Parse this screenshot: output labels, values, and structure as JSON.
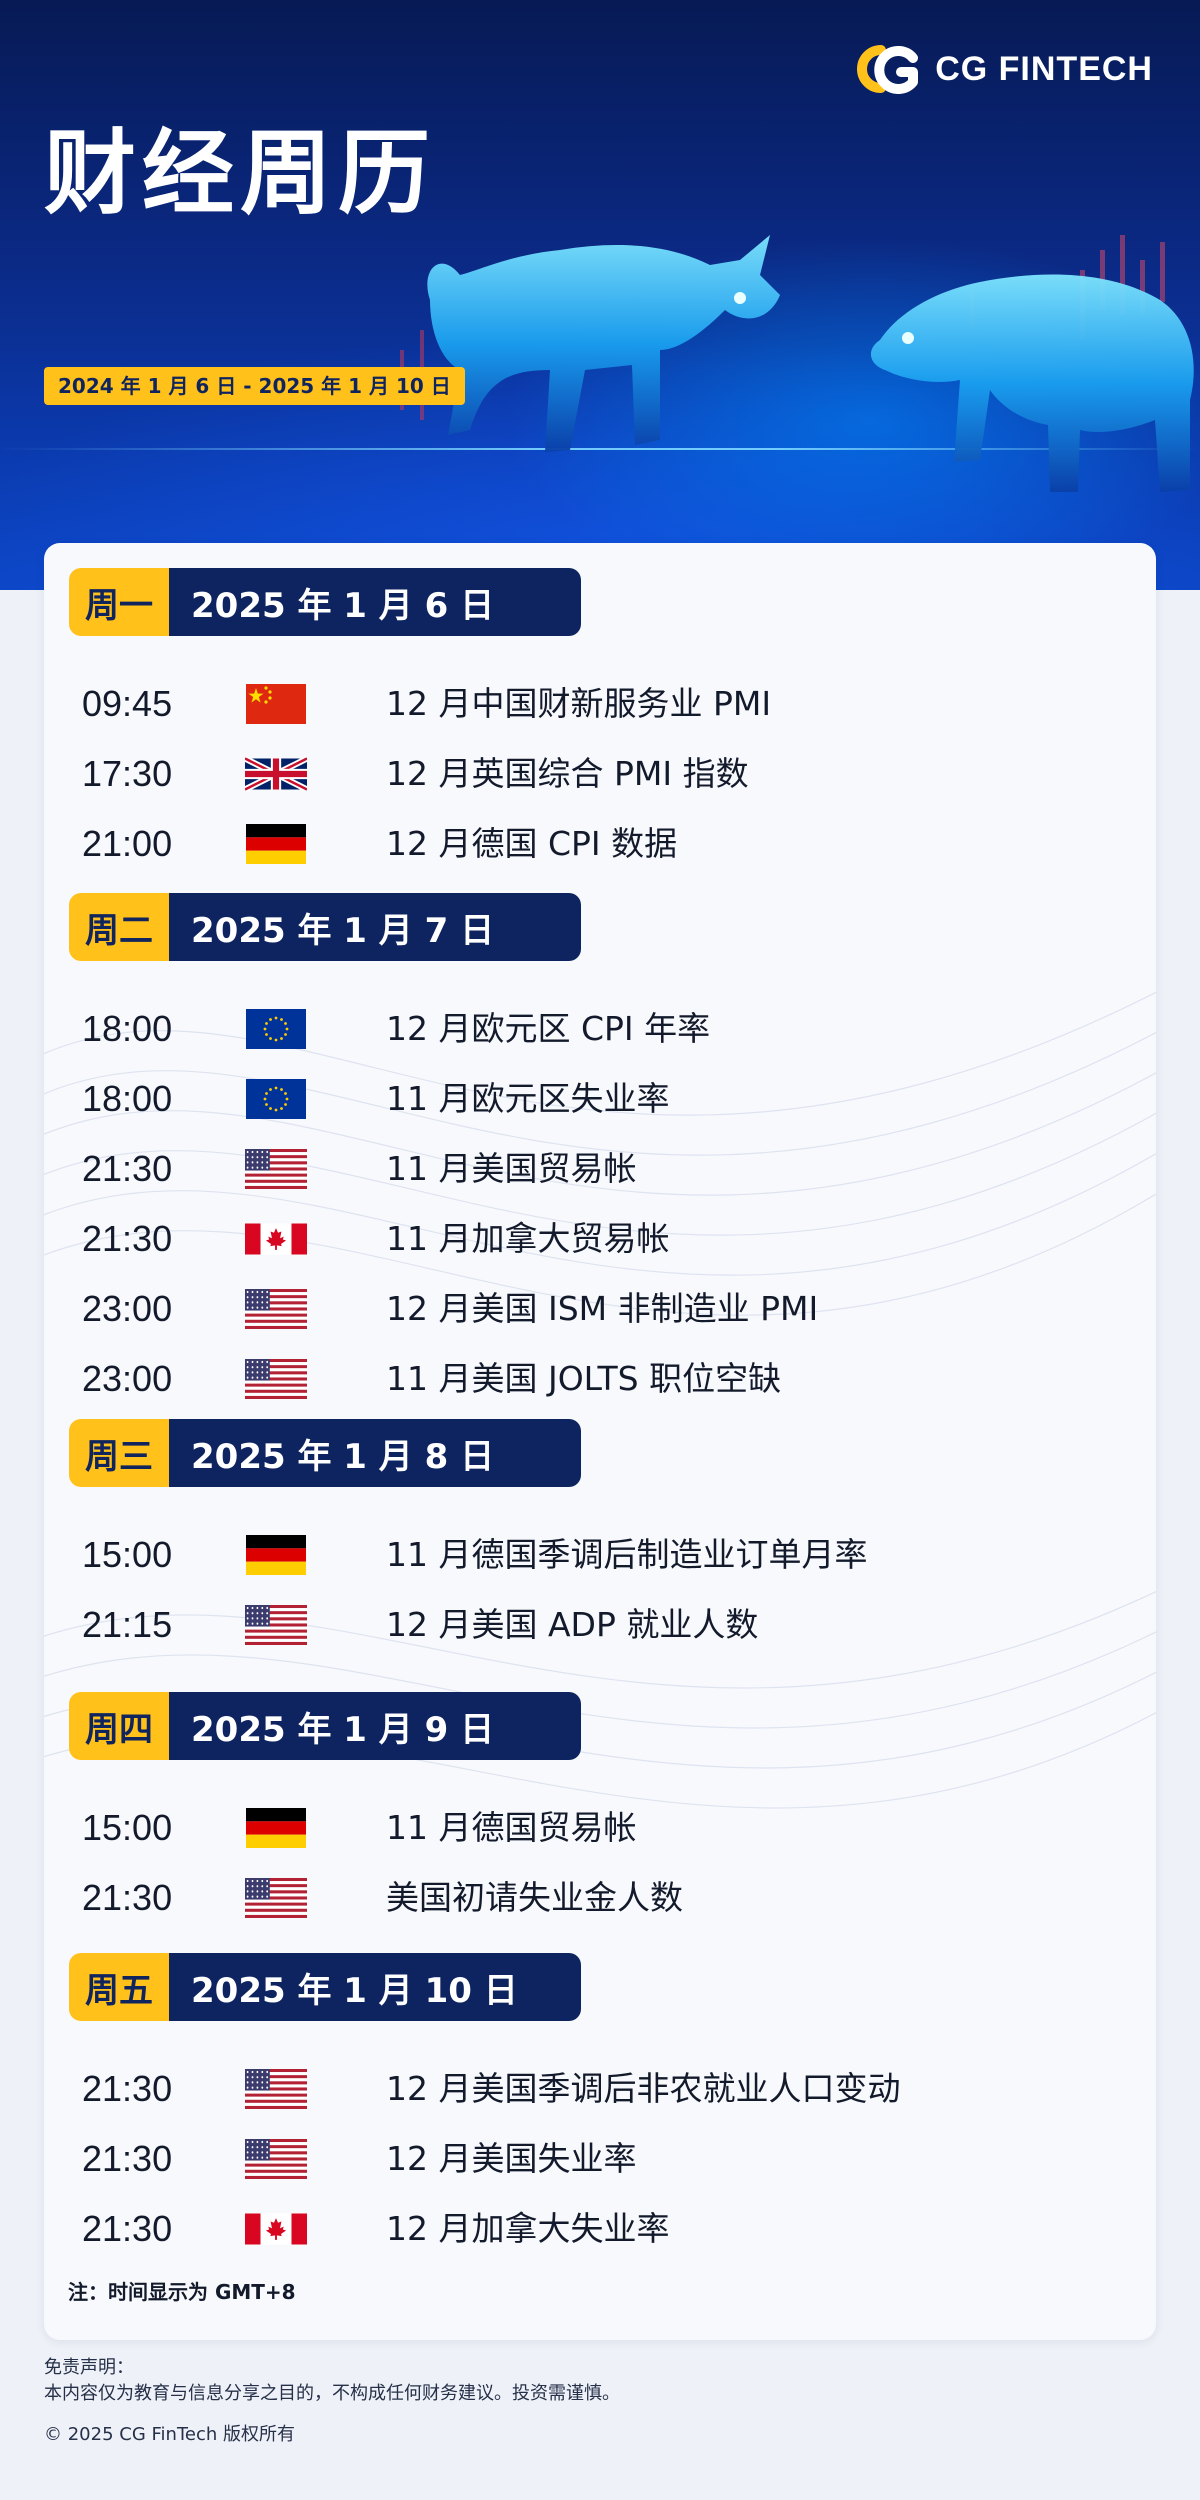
{
  "brand": {
    "logo_text": "CG FINTECH"
  },
  "hero": {
    "title": "财经周历",
    "date_range": "2024 年 1 月 6 日 - 2025 年 1 月 10 日"
  },
  "days": [
    {
      "weekday": "周一",
      "date": "2025 年 1 月 6 日",
      "events": [
        {
          "time": "09:45",
          "country": "cn",
          "title": "12 月中国财新服务业 PMI"
        },
        {
          "time": "17:30",
          "country": "uk",
          "title": "12 月英国综合 PMI 指数"
        },
        {
          "time": "21:00",
          "country": "de",
          "title": "12 月德国 CPI 数据"
        }
      ]
    },
    {
      "weekday": "周二",
      "date": "2025 年 1 月 7 日",
      "events": [
        {
          "time": "18:00",
          "country": "eu",
          "title": "12 月欧元区 CPI 年率"
        },
        {
          "time": "18:00",
          "country": "eu",
          "title": "11 月欧元区失业率"
        },
        {
          "time": "21:30",
          "country": "us",
          "title": "11 月美国贸易帐"
        },
        {
          "time": "21:30",
          "country": "ca",
          "title": "11 月加拿大贸易帐"
        },
        {
          "time": "23:00",
          "country": "us",
          "title": "12 月美国 ISM 非制造业 PMI"
        },
        {
          "time": "23:00",
          "country": "us",
          "title": "11 月美国 JOLTS 职位空缺"
        }
      ]
    },
    {
      "weekday": "周三",
      "date": "2025 年 1 月 8 日",
      "events": [
        {
          "time": "15:00",
          "country": "de",
          "title": "11 月德国季调后制造业订单月率"
        },
        {
          "time": "21:15",
          "country": "us",
          "title": "12 月美国 ADP 就业人数"
        }
      ]
    },
    {
      "weekday": "周四",
      "date": "2025 年 1 月 9 日",
      "events": [
        {
          "time": "15:00",
          "country": "de",
          "title": "11 月德国贸易帐"
        },
        {
          "time": "21:30",
          "country": "us",
          "title": "美国初请失业金人数"
        }
      ]
    },
    {
      "weekday": "周五",
      "date": "2025 年 1 月 10 日",
      "events": [
        {
          "time": "21:30",
          "country": "us",
          "title": "12 月美国季调后非农就业人口变动"
        },
        {
          "time": "21:30",
          "country": "us",
          "title": "12 月美国失业率"
        },
        {
          "time": "21:30",
          "country": "ca",
          "title": "12 月加拿大失业率"
        }
      ]
    }
  ],
  "note": "注：时间显示为 GMT+8",
  "footer": {
    "disclaimer_title": "免责声明：",
    "disclaimer_text": "本内容仅为教育与信息分享之目的，不构成任何财务建议。投资需谨慎。",
    "copyright": "© 2025 CG FinTech 版权所有"
  },
  "colors": {
    "accent_yellow": "#ffc11a",
    "navy": "#0e2461",
    "hero_blue": "#0b2a86"
  }
}
